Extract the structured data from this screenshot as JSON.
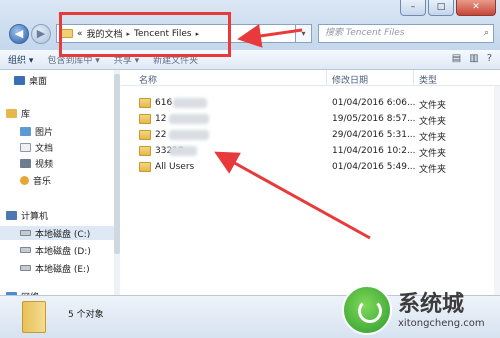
{
  "window": {
    "buttons": {
      "minimize": "–",
      "maximize": "□",
      "close": "✕"
    }
  },
  "nav": {
    "back": "◀",
    "forward": "▶"
  },
  "address": {
    "overflow": "«",
    "crumbs": [
      "我的文档",
      "Tencent Files"
    ],
    "sep": "▸",
    "dropdown": "▾"
  },
  "search": {
    "placeholder": "搜索 Tencent Files",
    "icon": "search-icon"
  },
  "toolbar": {
    "items": [
      "组织 ▾",
      "包含到库中 ▾",
      "共享 ▾",
      "新建文件夹"
    ],
    "view_icons": [
      "▤",
      "▥",
      "?"
    ]
  },
  "sidebar": {
    "favorites": [
      {
        "label": "桌面",
        "icon": "desktop-icon"
      }
    ],
    "libraries_title": "库",
    "libraries": [
      {
        "label": "图片",
        "icon": "pictures-icon"
      },
      {
        "label": "文档",
        "icon": "documents-icon"
      },
      {
        "label": "视频",
        "icon": "videos-icon"
      },
      {
        "label": "音乐",
        "icon": "music-icon"
      }
    ],
    "computer_title": "计算机",
    "drives": [
      {
        "label": "本地磁盘 (C:)"
      },
      {
        "label": "本地磁盘 (D:)"
      },
      {
        "label": "本地磁盘 (E:)"
      }
    ],
    "network_title": "网络"
  },
  "columns": {
    "name": "名称",
    "modified": "修改日期",
    "type": "类型"
  },
  "files": [
    {
      "name": "616",
      "modified": "01/04/2016 6:06...",
      "type": "文件夹"
    },
    {
      "name": "12",
      "modified": "19/05/2016 8:57...",
      "type": "文件夹"
    },
    {
      "name": "22",
      "modified": "29/04/2016 5:31...",
      "type": "文件夹"
    },
    {
      "name": "33218",
      "modified": "11/04/2016 10:2...",
      "type": "文件夹"
    },
    {
      "name": "All Users",
      "modified": "01/04/2016 5:49...",
      "type": "文件夹"
    }
  ],
  "status": {
    "count": "5 个对象"
  },
  "watermark": {
    "title": "系统城",
    "url": "xitongcheng.com"
  },
  "colors": {
    "annotation": "#e83a3a",
    "accent": "#3b6fb5"
  }
}
